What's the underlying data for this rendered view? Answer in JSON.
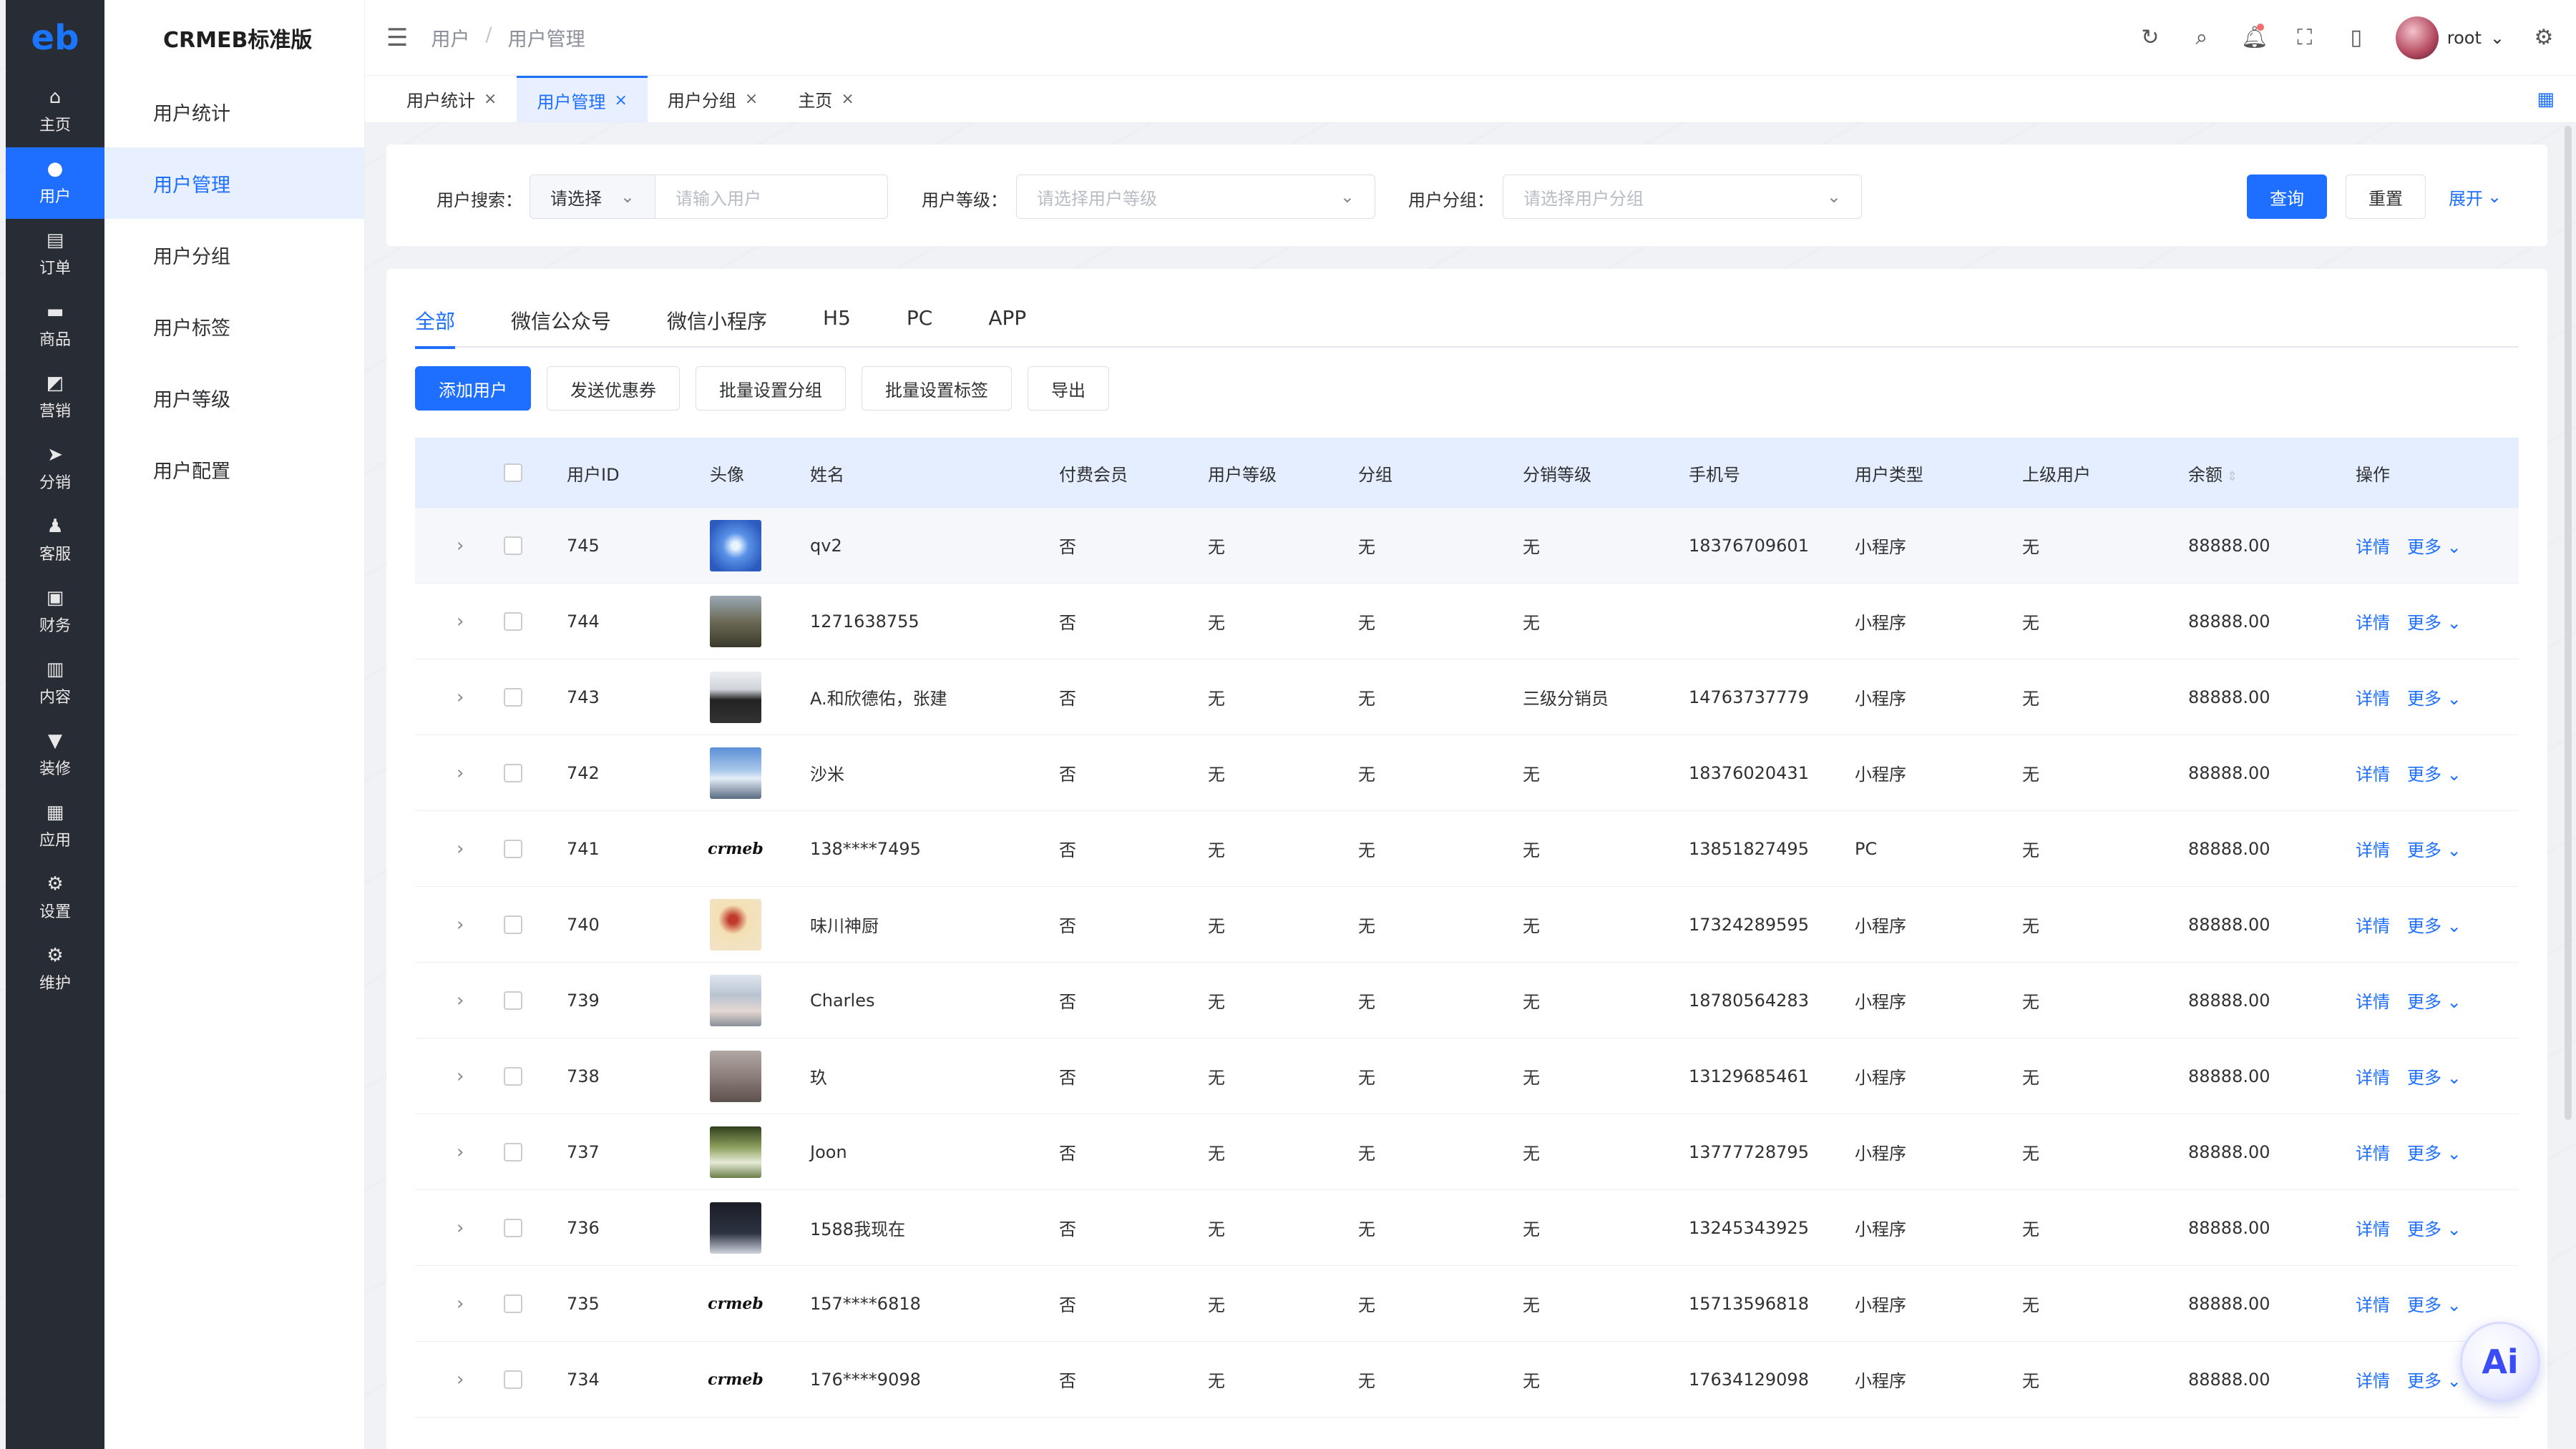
{
  "rail": {
    "logo": "eb",
    "items": [
      {
        "label": "主页",
        "icon": "home-icon",
        "glyph": "⌂"
      },
      {
        "label": "用户",
        "icon": "user-icon",
        "glyph": "●",
        "active": true
      },
      {
        "label": "订单",
        "icon": "order-icon",
        "glyph": "▤"
      },
      {
        "label": "商品",
        "icon": "product-icon",
        "glyph": "▬"
      },
      {
        "label": "营销",
        "icon": "marketing-icon",
        "glyph": "◩"
      },
      {
        "label": "分销",
        "icon": "distribution-icon",
        "glyph": "➤"
      },
      {
        "label": "客服",
        "icon": "service-icon",
        "glyph": "♟"
      },
      {
        "label": "财务",
        "icon": "finance-icon",
        "glyph": "▣"
      },
      {
        "label": "内容",
        "icon": "content-icon",
        "glyph": "▥"
      },
      {
        "label": "装修",
        "icon": "decoration-icon",
        "glyph": "▼"
      },
      {
        "label": "应用",
        "icon": "apps-icon",
        "glyph": "▦"
      },
      {
        "label": "设置",
        "icon": "settings-icon",
        "glyph": "⚙"
      },
      {
        "label": "维护",
        "icon": "maintenance-icon",
        "glyph": "⚙"
      }
    ]
  },
  "submenu": {
    "brand": "CRMEB标准版",
    "items": [
      {
        "label": "用户统计"
      },
      {
        "label": "用户管理",
        "active": true
      },
      {
        "label": "用户分组"
      },
      {
        "label": "用户标签"
      },
      {
        "label": "用户等级"
      },
      {
        "label": "用户配置"
      }
    ]
  },
  "header": {
    "breadcrumb": [
      "用户",
      "用户管理"
    ],
    "username": "root"
  },
  "tagbar": {
    "tags": [
      {
        "label": "用户统计"
      },
      {
        "label": "用户管理",
        "active": true
      },
      {
        "label": "用户分组"
      },
      {
        "label": "主页"
      }
    ]
  },
  "filter": {
    "search_label": "用户搜索：",
    "search_select": "请选择",
    "search_placeholder": "请输入用户",
    "level_label": "用户等级：",
    "level_placeholder": "请选择用户等级",
    "group_label": "用户分组：",
    "group_placeholder": "请选择用户分组",
    "query": "查询",
    "reset": "重置",
    "expand": "展开"
  },
  "tabs": [
    "全部",
    "微信公众号",
    "微信小程序",
    "H5",
    "PC",
    "APP"
  ],
  "actions": [
    "添加用户",
    "发送优惠券",
    "批量设置分组",
    "批量设置标签",
    "导出"
  ],
  "table": {
    "headers": [
      "用户ID",
      "头像",
      "姓名",
      "付费会员",
      "用户等级",
      "分组",
      "分销等级",
      "手机号",
      "用户类型",
      "上级用户",
      "余额",
      "操作"
    ],
    "rows": [
      {
        "id": "745",
        "name": "qv2",
        "paid": "否",
        "level": "无",
        "group": "无",
        "dist": "无",
        "phone": "18376709601",
        "type": "小程序",
        "sup": "无",
        "balance": "88888.00"
      },
      {
        "id": "744",
        "name": "1271638755",
        "paid": "否",
        "level": "无",
        "group": "无",
        "dist": "无",
        "phone": "",
        "type": "小程序",
        "sup": "无",
        "balance": "88888.00"
      },
      {
        "id": "743",
        "name": "A.和欣德佑，张建",
        "paid": "否",
        "level": "无",
        "group": "无",
        "dist": "三级分销员",
        "phone": "14763737779",
        "type": "小程序",
        "sup": "无",
        "balance": "88888.00"
      },
      {
        "id": "742",
        "name": "沙米",
        "paid": "否",
        "level": "无",
        "group": "无",
        "dist": "无",
        "phone": "18376020431",
        "type": "小程序",
        "sup": "无",
        "balance": "88888.00"
      },
      {
        "id": "741",
        "name": "138****7495",
        "paid": "否",
        "level": "无",
        "group": "无",
        "dist": "无",
        "phone": "13851827495",
        "type": "PC",
        "sup": "无",
        "balance": "88888.00"
      },
      {
        "id": "740",
        "name": "味川神厨",
        "paid": "否",
        "level": "无",
        "group": "无",
        "dist": "无",
        "phone": "17324289595",
        "type": "小程序",
        "sup": "无",
        "balance": "88888.00"
      },
      {
        "id": "739",
        "name": "Charles",
        "paid": "否",
        "level": "无",
        "group": "无",
        "dist": "无",
        "phone": "18780564283",
        "type": "小程序",
        "sup": "无",
        "balance": "88888.00"
      },
      {
        "id": "738",
        "name": "玖",
        "paid": "否",
        "level": "无",
        "group": "无",
        "dist": "无",
        "phone": "13129685461",
        "type": "小程序",
        "sup": "无",
        "balance": "88888.00"
      },
      {
        "id": "737",
        "name": "Joon",
        "paid": "否",
        "level": "无",
        "group": "无",
        "dist": "无",
        "phone": "13777728795",
        "type": "小程序",
        "sup": "无",
        "balance": "88888.00"
      },
      {
        "id": "736",
        "name": "1588我现在",
        "paid": "否",
        "level": "无",
        "group": "无",
        "dist": "无",
        "phone": "13245343925",
        "type": "小程序",
        "sup": "无",
        "balance": "88888.00"
      },
      {
        "id": "735",
        "name": "157****6818",
        "paid": "否",
        "level": "无",
        "group": "无",
        "dist": "无",
        "phone": "15713596818",
        "type": "小程序",
        "sup": "无",
        "balance": "88888.00"
      },
      {
        "id": "734",
        "name": "176****9098",
        "paid": "否",
        "level": "无",
        "group": "无",
        "dist": "无",
        "phone": "17634129098",
        "type": "小程序",
        "sup": "无",
        "balance": "88888.00"
      }
    ],
    "op_detail": "详情",
    "op_more": "更多",
    "logo_text": "crmeb"
  },
  "ai_button": "Ai",
  "colors": {
    "primary": "#1e6fff",
    "rail": "#282c34",
    "header_row": "#e5eeff"
  }
}
